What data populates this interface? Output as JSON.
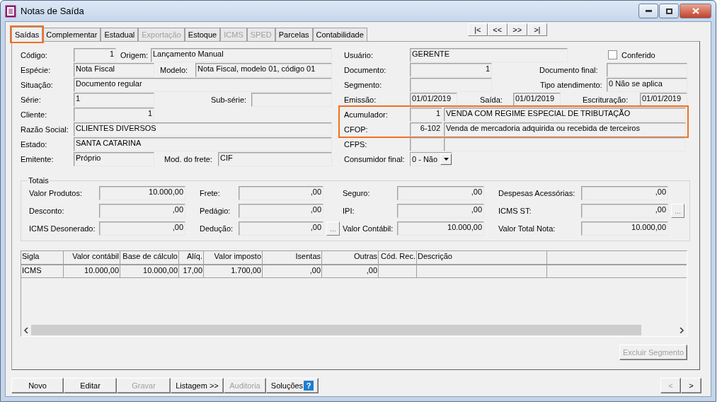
{
  "window": {
    "title": "Notas de Saída"
  },
  "tabs": [
    {
      "label": "Saídas",
      "selected": true,
      "disabled": false,
      "highlighted": true
    },
    {
      "label": "Complementar",
      "selected": false,
      "disabled": false,
      "highlighted": false
    },
    {
      "label": "Estadual",
      "selected": false,
      "disabled": false,
      "highlighted": false
    },
    {
      "label": "Exportação",
      "selected": false,
      "disabled": true,
      "highlighted": false
    },
    {
      "label": "Estoque",
      "selected": false,
      "disabled": false,
      "highlighted": false
    },
    {
      "label": "ICMS",
      "selected": false,
      "disabled": true,
      "highlighted": false
    },
    {
      "label": "SPED",
      "selected": false,
      "disabled": true,
      "highlighted": false
    },
    {
      "label": "Parcelas",
      "selected": false,
      "disabled": false,
      "highlighted": false
    },
    {
      "label": "Contabilidade",
      "selected": false,
      "disabled": false,
      "highlighted": false
    }
  ],
  "record_nav": [
    "|<",
    "<<",
    ">>",
    ">|"
  ],
  "left_rows": [
    [
      {
        "label": "Código:",
        "value": "1",
        "kind": "number"
      },
      {
        "label": "Origem:",
        "value": "Lançamento Manual",
        "kind": "text"
      }
    ],
    [
      {
        "label": "Espécie:",
        "value": "Nota Fiscal",
        "kind": "text"
      },
      {
        "label": "Modelo:",
        "value": "Nota Fiscal, modelo 01, código 01",
        "kind": "text"
      }
    ],
    [
      {
        "label": "Situação:",
        "value": "Documento regular",
        "kind": "text"
      }
    ],
    [
      {
        "label": "Série:",
        "value": "1",
        "kind": "text"
      },
      {
        "label": "Sub-série:",
        "kind": "text"
      }
    ],
    [
      {
        "label": "Cliente:",
        "value": "1",
        "kind": "number"
      }
    ],
    [
      {
        "label": "Razão Social:",
        "value": "CLIENTES DIVERSOS",
        "kind": "text"
      }
    ],
    [
      {
        "label": "Estado:",
        "value": "SANTA CATARINA",
        "kind": "text"
      }
    ],
    [
      {
        "label": "Emitente:",
        "value": "Próprio",
        "kind": "text"
      },
      {
        "label": "Mod. do frete:",
        "value": "CIF",
        "kind": "text"
      }
    ]
  ],
  "right_rows": [
    [
      {
        "label": "Usuário:",
        "value": "GERENTE",
        "kind": "text"
      },
      {
        "label": "Conferido",
        "kind": "checkbox",
        "checked": false
      }
    ],
    [
      {
        "label": "Documento:",
        "value": "1",
        "kind": "number"
      },
      {
        "label": "Documento final:",
        "kind": "text"
      }
    ],
    [
      {
        "label": "Segmento:",
        "kind": "text"
      },
      {
        "label": "Tipo atendimento:",
        "value": "0 Não se aplica",
        "kind": "text"
      }
    ],
    [
      {
        "label": "Emissão:",
        "value": "01/01/2019",
        "kind": "text"
      },
      {
        "label": "Saída:",
        "value": "01/01/2019",
        "kind": "text"
      },
      {
        "label": "Escrituração:",
        "value": "01/01/2019",
        "kind": "text"
      }
    ]
  ],
  "accumulator_group": {
    "highlighted": true,
    "rows": [
      [
        {
          "label": "Acumulador:",
          "value": "1",
          "kind": "number"
        },
        {
          "value": "VENDA COM REGIME ESPECIAL DE TRIBUTAÇÃO",
          "kind": "text"
        }
      ],
      [
        {
          "label": "CFOP:",
          "value": "6-102",
          "kind": "number"
        },
        {
          "value": "Venda de mercadoria adquirida ou recebida de terceiros",
          "kind": "text"
        }
      ]
    ]
  },
  "right_rows_after": [
    [
      {
        "label": "CFPS:",
        "kind": "number"
      },
      {
        "kind": "text"
      }
    ],
    [
      {
        "label": "Consumidor final:",
        "value": "0 - Não",
        "kind": "select"
      }
    ]
  ],
  "totals": {
    "title": "Totais",
    "rows": [
      [
        {
          "label": "Valor Produtos:",
          "value": "10.000,00"
        },
        {
          "label": "Frete:",
          "value": ",00"
        },
        {
          "label": "Seguro:",
          "value": ",00"
        },
        {
          "label": "Despesas Acessórias:",
          "value": ",00"
        }
      ],
      [
        {
          "label": "Desconto:",
          "value": ",00"
        },
        {
          "label": "Pedágio:",
          "value": ",00"
        },
        {
          "label": "IPI:",
          "value": ",00"
        },
        {
          "label": "ICMS ST:",
          "value": ",00",
          "button": "..."
        }
      ],
      [
        {
          "label": "ICMS Desonerado:",
          "value": ",00"
        },
        {
          "label": "Dedução:",
          "value": ",00",
          "button": "..."
        },
        {
          "label": "Valor Contábil:",
          "value": "10.000,00"
        },
        {
          "label": "Valor Total Nota:",
          "value": "10.000,00"
        }
      ]
    ]
  },
  "tax_table": {
    "columns": [
      "Sigla",
      "Valor contábil",
      "Base de cálculo",
      "Alíq.",
      "Valor imposto",
      "Isentas",
      "Outras",
      "Cód. Rec.",
      "Descrição"
    ],
    "rows": [
      [
        "ICMS",
        "10.000,00",
        "10.000,00",
        "17,00",
        "1.700,00",
        ",00",
        ",00"
      ]
    ]
  },
  "segment_button": {
    "label": "Excluir Segmento",
    "disabled": true
  },
  "bottom_buttons": [
    {
      "label": "Novo",
      "disabled": false
    },
    {
      "label": "Editar",
      "disabled": false
    },
    {
      "label": "Gravar",
      "disabled": true
    },
    {
      "label": "Listagem >>",
      "disabled": false
    },
    {
      "label": "Auditoria",
      "disabled": true
    },
    {
      "label": "Soluções",
      "disabled": false,
      "icon": "?"
    }
  ],
  "page_nav": [
    {
      "label": "<",
      "disabled": true
    },
    {
      "label": ">",
      "disabled": false
    }
  ]
}
